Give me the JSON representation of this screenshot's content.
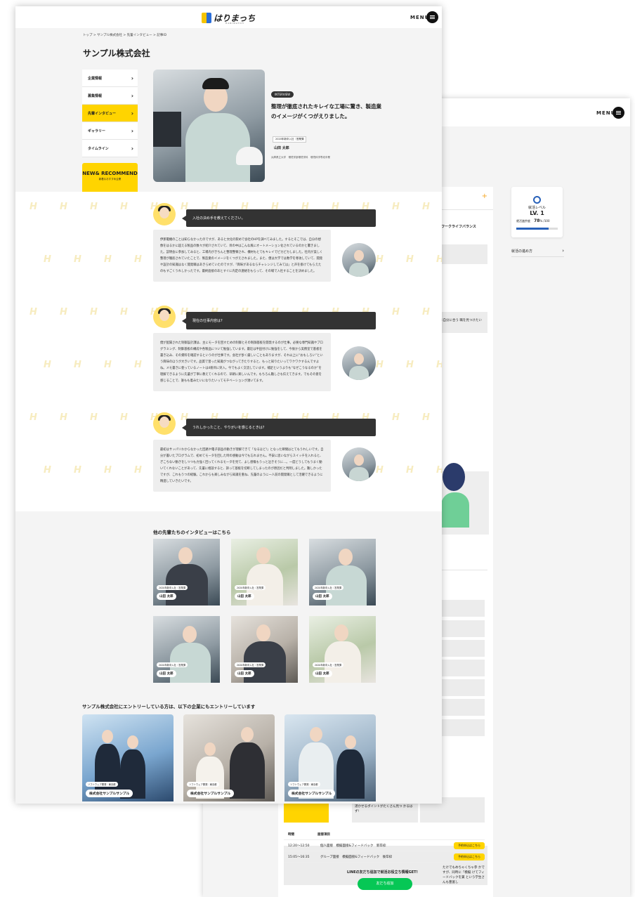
{
  "back": {
    "menu_label": "MENU",
    "heading_fragment": "ワークライフバランス",
    "level_title": "就活レベル",
    "level_value": "LV. 1",
    "progress_label": "就活進捗度",
    "progress_value": "78",
    "progress_unit": "% /100",
    "progress_fraction": 0.78,
    "guide_link": "就活の進め方",
    "tip_text": "に自分に合う 職を見つけたい",
    "side_text": "たけでもめちゃくちゃ参 かですが、同時に「模擬 けてフィードバックを貰 という学生さんも豊富し",
    "point_text": "湛かせるポイントがたくさん見つ かるはず!",
    "schedule": {
      "col_time": "時間",
      "col_content": "面接項目",
      "rows": [
        {
          "time": "12:20〜12:50",
          "content": "個人面接　模擬面接&フィードバック　新卒枠",
          "button": "予約申込はこちら"
        },
        {
          "time": "15:05〜16:35",
          "content": "グループ面接　模擬面接&フィードバック　後卒枠",
          "button": "予約申込はこちら"
        }
      ]
    },
    "line_text": "LINEの友だち追加で就活お役立ち情報GET!",
    "line_button": "友だち追加"
  },
  "front": {
    "logo": "はりまっち",
    "logo_sub": "HARIMATCH",
    "menu_label": "MENU",
    "breadcrumb": "トップ > サンプル株式会社 > 先輩インタビュー > 記事ID",
    "page_title": "サンプル株式会社",
    "side_nav": [
      "企業情報",
      "募集情報",
      "先輩インタビュー",
      "ギャラリー",
      "タイムライン"
    ],
    "new_recommend": {
      "title": "NEW& RECOMMEND",
      "sub": "新着＆おすすめ企業"
    },
    "interview": {
      "badge": "INTERVIEW",
      "headline": "整理が徹底されたキレイな工場に驚き、製造業のイメージがくつがえりました。",
      "tag": "2020年新卒入社｜営業課",
      "name": "山田 太郎",
      "school": "兵庫県立大学　環境学部環境学科　環境科学専攻卒業"
    },
    "qa": [
      {
        "question": "入社の決め手を教えてください。",
        "answer": "伊那電機のことは知らなかったのですが、あると文化の飲めで会社のHPを調べてみました。するとそこでは、自分の想像をはるかに超える製品の数々が紹介されていて、目の中はこんな風にオートメーション化されているのかと驚きました。説明会に参加してみると、工場内がきちんと整理整頓され、機材もとてもキレイでピカピカしました。社内が美しく整理が徹底されていたことで、製造業のイメージをくつがえされました。また、僕は大学では数学を専攻していて、開発や設計の知識はなく開発職はあきらめていたのですが、「興味があるならチャレンジしてみては」と声を掛けてもらえたのもすごくうれしかったです。最終面接のあとすぐに内定の連絡をもらって、その場で入社することを決めました。"
      },
      {
        "question": "現在の仕事内容は?",
        "answer": "僕が配属された制御設計課は、主にモータを回すための制御とその制御基板を開発するのが仕事。必要な専門知識やプログラミング、制御基板の構成や各製品について勉強しています。最近は半田付けに勉強をして、今後から実務室で基板を書き込み、その資料を確認するというのが仕事です。会社が歩く厳しいこともありますが、それ以上に“おもしろい”という興味のほうが大きいです。品質で習った知識がつながってきたりすると、もっと知りたいってワクワクするんですよね。メモ書きに使っているノートは4冊目に突入。今でもよく交流しています。補足というよりも“なぜこうなるのか”を理解できるように先輩が丁寧に教えてくれるので、早朝に楽しいんです。もちろん難しさも伝えてきます。でもその意を感じることで、誰もも着みたいになりたいってモチベーションが湧いてます。"
      },
      {
        "question": "うれしかったこと、やりがいを感じるときは?",
        "answer": "最初はサッパリわからなかった回路や電子部品の動きが理解できて「なるほど!」となった瞬間はとてもうれしいです。自分が書いたプログラムで、初めてモータを回した時の感動は今でも忘れません。不安に思いながらスイッチを入れると、ぎこちない動きをしつつも力強く回ってくれるモータを見て、よし感慨もうっと泣きそうに…。一度どうしてもうまく動いてくれないことがあって、先輩に相談すると、諦って基板を切断してしまったのが原因だと判明しました。難しかったですが、これもうつの経験。これからも楽しみながら知識を重ね、先輩のように一人前の開発職として活躍できるように精進していきたいです。"
      }
    ],
    "others_title": "他の先輩たちのインタビューはこちら",
    "others": [
      {
        "tag": "2020年新卒入社｜営業課",
        "name": "山田 太郎"
      },
      {
        "tag": "2020年新卒入社｜営業課",
        "name": "山田 太郎"
      },
      {
        "tag": "2020年新卒入社｜営業課",
        "name": "山田 太郎"
      },
      {
        "tag": "2020年新卒入社｜営業課",
        "name": "山田 太郎"
      },
      {
        "tag": "2020年新卒入社｜営業課",
        "name": "山田 太郎"
      },
      {
        "tag": "2020年新卒入社｜営業課",
        "name": "山田 太郎"
      }
    ],
    "related_title": "サンプル株式会社にエントリーしている方は、以下の企業にもエントリーしています",
    "related": [
      {
        "tag": "ソフトウェア開発｜東京都",
        "name": "株式会社サンプルサンプル"
      },
      {
        "tag": "ソフトウェア開発｜東京都",
        "name": "株式会社サンプルサンプル"
      },
      {
        "tag": "ソフトウェア開発｜東京都",
        "name": "株式会社サンプルサンプル"
      }
    ]
  },
  "colors": {
    "accent": "#ffd400",
    "dark": "#333333",
    "line": "#06c755",
    "blue": "#2861b9"
  }
}
